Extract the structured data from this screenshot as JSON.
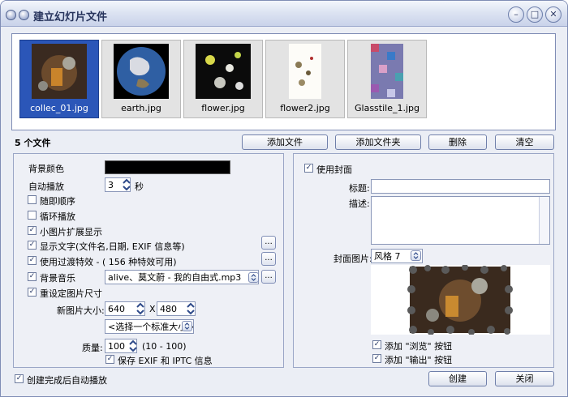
{
  "window": {
    "title": "建立幻灯片文件"
  },
  "titlebar": {
    "minimize": "–",
    "maximize": "□",
    "close": "✕"
  },
  "thumbnails": [
    {
      "name": "collec_01.jpg",
      "selected": true
    },
    {
      "name": "earth.jpg",
      "selected": false
    },
    {
      "name": "flower.jpg",
      "selected": false
    },
    {
      "name": "flower2.jpg",
      "selected": false
    },
    {
      "name": "Glasstile_1.jpg",
      "selected": false
    }
  ],
  "file_count": "5 个文件",
  "file_buttons": {
    "add_file": "添加文件",
    "add_folder": "添加文件夹",
    "delete": "删除",
    "clear": "清空"
  },
  "settings": {
    "bg_color_label": "背景颜色",
    "bg_color": "#000000",
    "autoplay_label": "自动播放",
    "autoplay_value": "3",
    "autoplay_unit": "秒",
    "random_order": "随即顺序",
    "loop_play": "循环播放",
    "expand_small": "小图片扩展显示",
    "show_text": "显示文字(文件名,日期, EXIF 信息等)",
    "use_transition": "使用过渡特效 - ( 156 种特效可用)",
    "bg_music": "背景音乐",
    "music_file": "alive、莫文蔚 - 我的自由式.mp3",
    "resize": "重设定图片尺寸",
    "new_size_label": "新图片大小:",
    "width": "640",
    "times": "X",
    "height": "480",
    "std_size": "<选择一个标准大小>",
    "quality_label": "质量:",
    "quality": "100",
    "quality_range": "(10 - 100)",
    "keep_exif": "保存 EXIF 和 IPTC 信息"
  },
  "cover": {
    "use_cover": "使用封面",
    "title_label": "标题:",
    "title_value": "",
    "desc_label": "描述:",
    "desc_value": "",
    "image_label": "封面图片:",
    "style": "风格 7",
    "add_browse": "添加 \"浏览\" 按钮",
    "add_output": "添加 \"输出\" 按钮"
  },
  "footer": {
    "autoplay_after": "创建完成后自动播放",
    "create": "创建",
    "close": "关闭"
  },
  "colors": {
    "selected": "#2b56b8",
    "window_bg": "#ebeef5",
    "border": "#7f8db5"
  },
  "icons": [
    "app-icon",
    "pin-icon",
    "minimize-icon",
    "maximize-icon",
    "close-icon",
    "checkmark-icon",
    "spin-arrows-icon",
    "dropdown-arrow-icon"
  ]
}
